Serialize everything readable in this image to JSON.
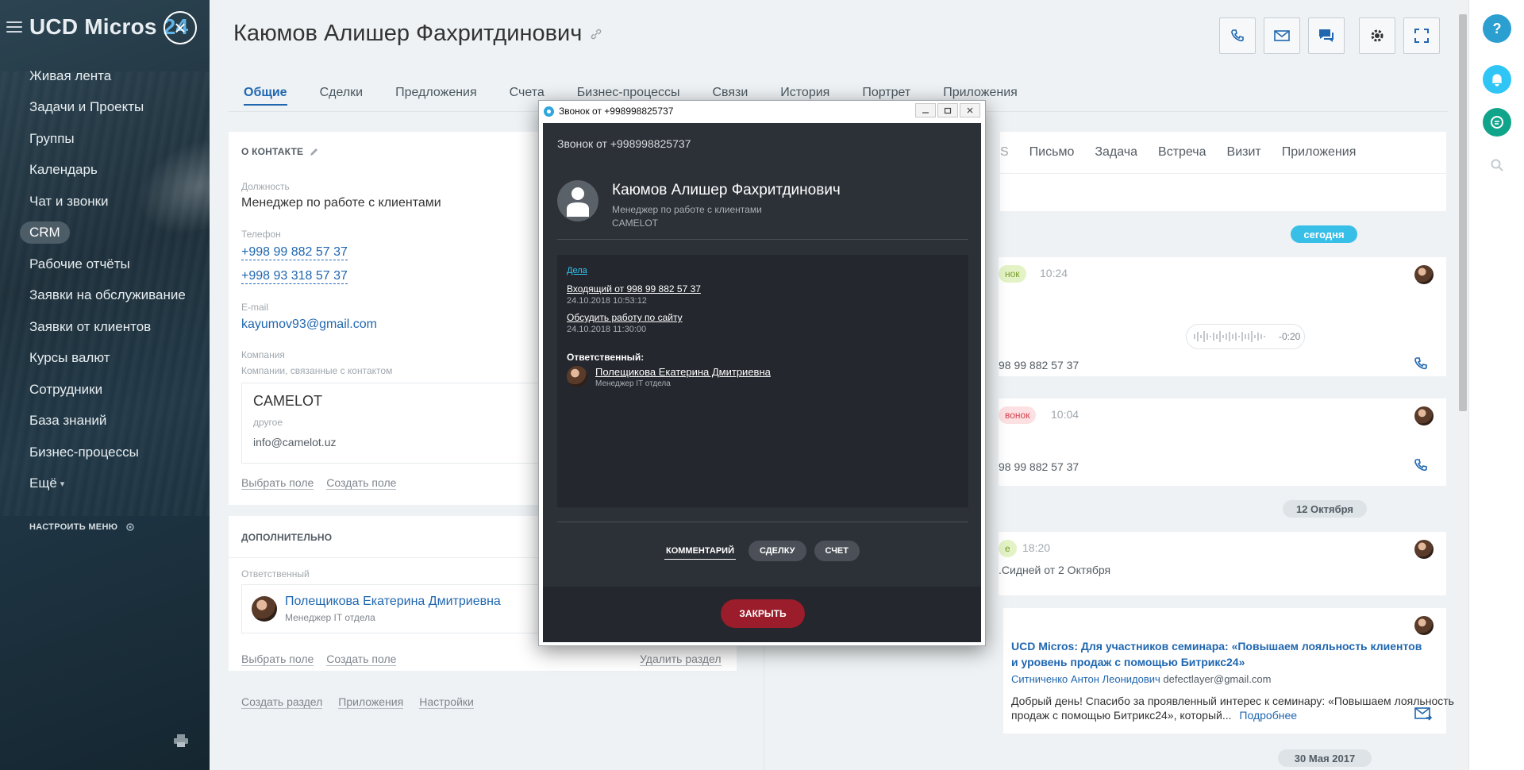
{
  "sidebar": {
    "brand": "UCD Micros",
    "brand_num": "24",
    "items": [
      {
        "label": "Живая лента"
      },
      {
        "label": "Задачи и Проекты"
      },
      {
        "label": "Группы"
      },
      {
        "label": "Календарь"
      },
      {
        "label": "Чат и звонки"
      },
      {
        "label": "CRM"
      },
      {
        "label": "Рабочие отчёты"
      },
      {
        "label": "Заявки на обслуживание"
      },
      {
        "label": "Заявки от клиентов"
      },
      {
        "label": "Курсы валют"
      },
      {
        "label": "Сотрудники"
      },
      {
        "label": "База знаний"
      },
      {
        "label": "Бизнес-процессы"
      },
      {
        "label": "Ещё"
      }
    ],
    "settings": "НАСТРОИТЬ МЕНЮ"
  },
  "page": {
    "title": "Каюмов Алишер Фахритдинович",
    "tabs": [
      "Общие",
      "Сделки",
      "Предложения",
      "Счета",
      "Бизнес-процессы",
      "Связи",
      "История",
      "Портрет",
      "Приложения"
    ]
  },
  "contact": {
    "section_title": "О КОНТАКТЕ",
    "position_label": "Должность",
    "position_value": "Менеджер по работе с клиентами",
    "phone_label": "Телефон",
    "phones": [
      "+998 99 882 57 37",
      "+998 93 318 57 37"
    ],
    "email_label": "E-mail",
    "email": "kayumov93@gmail.com",
    "company_label": "Компания",
    "company_sub": "Компании, связанные с контактом",
    "company_name": "CAMELOT",
    "company_type": "другое",
    "company_email": "info@camelot.uz",
    "select_field": "Выбрать поле",
    "create_field": "Создать поле"
  },
  "extra": {
    "section_title": "ДОПОЛНИТЕЛЬНО",
    "responsible_label": "Ответственный",
    "responsible_name": "Полещикова Екатерина Дмитриевна",
    "responsible_role": "Менеджер IT отдела",
    "select_field": "Выбрать поле",
    "create_field": "Создать поле",
    "delete_section": "Удалить раздел"
  },
  "bottom_links": [
    "Создать раздел",
    "Приложения",
    "Настройки"
  ],
  "timeline": {
    "tabs_visible_fragment": "S",
    "tabs": [
      "Письмо",
      "Задача",
      "Встреча",
      "Визит",
      "Приложения"
    ],
    "today": "сегодня",
    "item1": {
      "pill": "нок",
      "time": "10:24",
      "audio_time": "-0:20",
      "phone": "98 99 882 57 37"
    },
    "item2": {
      "pill": "вонок",
      "time": "10:04",
      "phone": "98 99 882 57 37"
    },
    "date2": "12 Октября",
    "item3": {
      "pill": "е",
      "time": "18:20",
      "text": ".Сидней от 2 Октября"
    },
    "item4": {
      "subject": "UCD Micros: Для участников семинара: «Повышаем лояльность клиентов и уровень продаж с помощью Битрикс24»",
      "from_name": "Ситниченко Антон Леонидович",
      "from_email": "defectlayer@gmail.com",
      "body": "Добрый день! Спасибо за проявленный интерес к семинару: «Повышаем лояльность клиентов и уровень продаж с помощью Битрикс24», который...",
      "more": "Подробнее"
    },
    "date3": "30 Мая 2017"
  },
  "call_dialog": {
    "window_title": "Звонок от +998998825737",
    "header": "Звонок от +998998825737",
    "name": "Каюмов Алишер Фахритдинович",
    "position": "Менеджер по работе с клиентами",
    "company": "CAMELOT",
    "deals_label": "Дела",
    "deal1_title": "Входящий от 998 99 882 57 37",
    "deal1_date": "24.10.2018 10:53:12",
    "deal2_title": "Обсудить работу по сайту",
    "deal2_date": "24.10.2018 11:30:00",
    "responsible_label": "Ответственный:",
    "responsible_name": "Полещикова Екатерина Дмитриевна",
    "responsible_role": "Менеджер IT отдела",
    "actions": [
      "КОММЕНТАРИЙ",
      "СДЕЛКУ",
      "СЧЕТ"
    ],
    "close": "ЗАКРЫТЬ"
  },
  "right_strip": {
    "help": "?"
  },
  "colors": {
    "accent": "#2067b0",
    "today_badge": "#38bfe8",
    "close_button": "#9b1c2a",
    "dialog_bg": "#2c3037"
  }
}
